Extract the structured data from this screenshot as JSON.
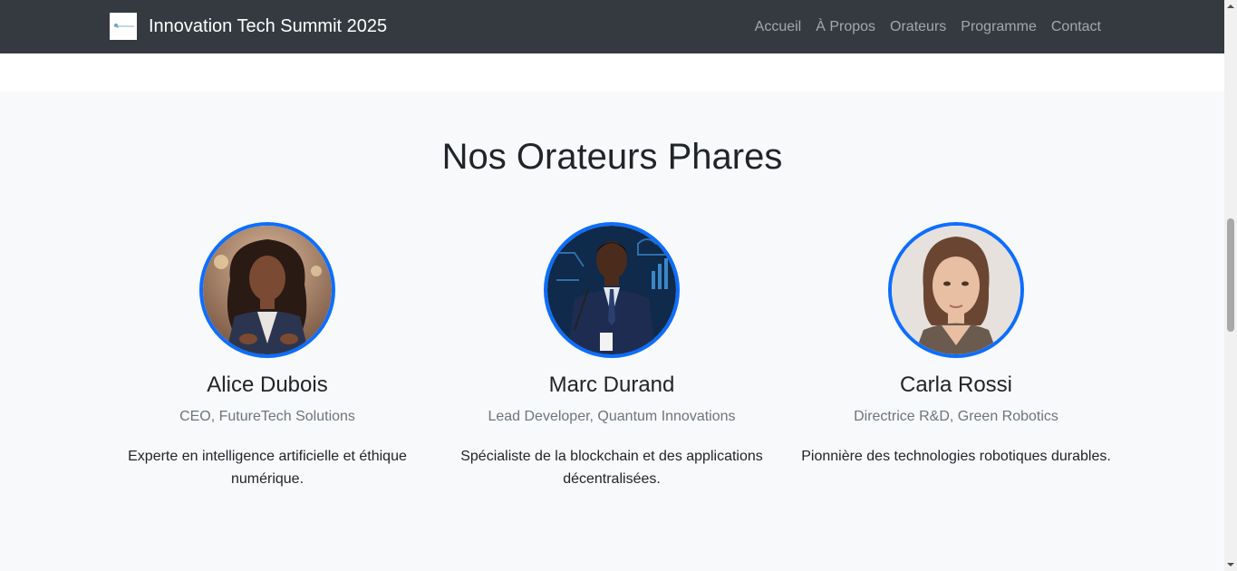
{
  "navbar": {
    "brand": "Innovation Tech Summit 2025",
    "links": [
      "Accueil",
      "À Propos",
      "Orateurs",
      "Programme",
      "Contact"
    ]
  },
  "speakers_section": {
    "title": "Nos Orateurs Phares",
    "speakers": [
      {
        "name": "Alice Dubois",
        "role": "CEO, FutureTech Solutions",
        "bio": "Experte en intelligence artificielle et éthique numérique."
      },
      {
        "name": "Marc Durand",
        "role": "Lead Developer, Quantum Innovations",
        "bio": "Spécialiste de la blockchain et des applications décentralisées."
      },
      {
        "name": "Carla Rossi",
        "role": "Directrice R&D, Green Robotics",
        "bio": "Pionnière des technologies robotiques durables."
      }
    ]
  },
  "colors": {
    "navbar_bg": "#343a40",
    "accent": "#0d6efd",
    "section_bg": "#f8f9fa"
  }
}
